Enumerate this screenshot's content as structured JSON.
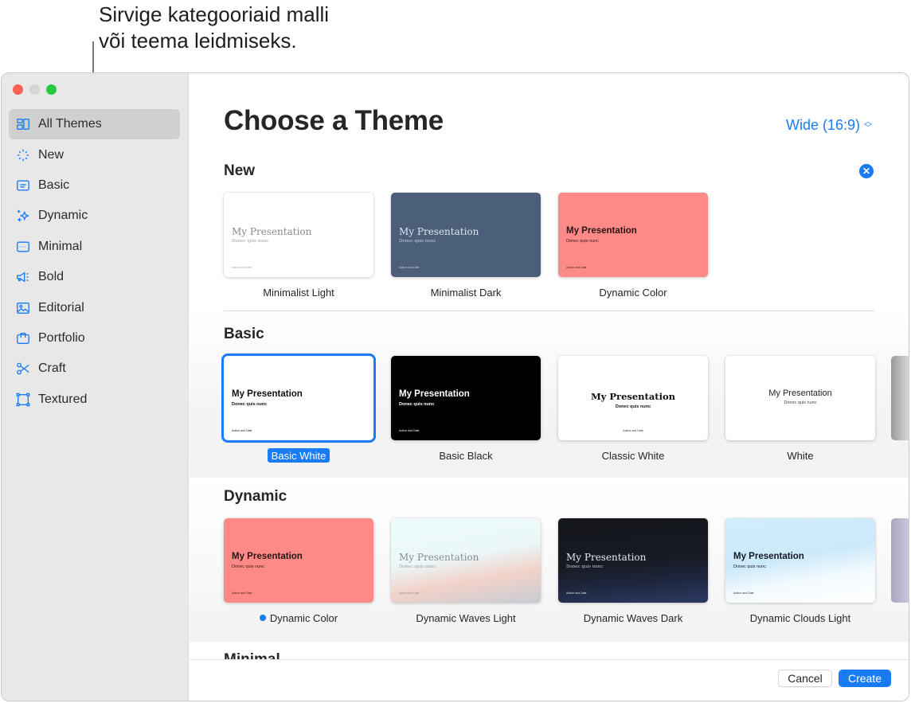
{
  "callout": {
    "line1": "Sirvige kategooriaid malli",
    "line2": "või teema leidmiseks."
  },
  "sidebar": {
    "items": [
      {
        "label": "All Themes",
        "icon": "all-themes-icon",
        "active": true
      },
      {
        "label": "New",
        "icon": "sparkle-burst-icon"
      },
      {
        "label": "Basic",
        "icon": "basic-slide-icon"
      },
      {
        "label": "Dynamic",
        "icon": "sparkles-icon"
      },
      {
        "label": "Minimal",
        "icon": "ellipsis-slide-icon"
      },
      {
        "label": "Bold",
        "icon": "megaphone-icon"
      },
      {
        "label": "Editorial",
        "icon": "photo-icon"
      },
      {
        "label": "Portfolio",
        "icon": "briefcase-icon"
      },
      {
        "label": "Craft",
        "icon": "scissors-icon"
      },
      {
        "label": "Textured",
        "icon": "frame-icon"
      }
    ]
  },
  "main": {
    "title": "Choose a Theme",
    "size_select": "Wide (16:9)",
    "sections": {
      "new": {
        "title": "New",
        "themes": [
          {
            "name": "Minimalist Light",
            "title": "My Presentation",
            "subtitle": "Donec quis nunc",
            "author": "Author and Date"
          },
          {
            "name": "Minimalist Dark",
            "title": "My Presentation",
            "subtitle": "Donec quis nunc",
            "author": "Author and Date"
          },
          {
            "name": "Dynamic Color",
            "title": "My Presentation",
            "subtitle": "Donec quis nunc",
            "author": "Author and Date"
          }
        ]
      },
      "basic": {
        "title": "Basic",
        "themes": [
          {
            "name": "Basic White",
            "title": "My Presentation",
            "subtitle": "Donec quis nunc",
            "author": "Author and Date",
            "selected": true
          },
          {
            "name": "Basic Black",
            "title": "My Presentation",
            "subtitle": "Donec quis nunc",
            "author": "Author and Date"
          },
          {
            "name": "Classic White",
            "title": "My Presentation",
            "subtitle": "Donec quis nunc",
            "author": "Author and Date"
          },
          {
            "name": "White",
            "title": "My Presentation",
            "subtitle": "Donec quis nunc"
          }
        ]
      },
      "dynamic": {
        "title": "Dynamic",
        "themes": [
          {
            "name": "Dynamic Color",
            "title": "My Presentation",
            "subtitle": "Donec quis nunc",
            "author": "Author and Date",
            "new_dot": true
          },
          {
            "name": "Dynamic Waves Light",
            "title": "My Presentation",
            "subtitle": "Donec quis nunc",
            "author": "Author and Date"
          },
          {
            "name": "Dynamic Waves Dark",
            "title": "My Presentation",
            "subtitle": "Donec quis nunc",
            "author": "Author and Date"
          },
          {
            "name": "Dynamic Clouds Light",
            "title": "My Presentation",
            "subtitle": "Donec quis nunc",
            "author": "Author and Date"
          }
        ]
      },
      "minimal": {
        "title": "Minimal"
      }
    }
  },
  "footer": {
    "cancel": "Cancel",
    "create": "Create"
  },
  "colors": {
    "accent": "#1a7cf5",
    "minimalist_dark": "#4b5e7a",
    "dynamic_color": "#fe8a87",
    "basic_black": "#000000"
  }
}
